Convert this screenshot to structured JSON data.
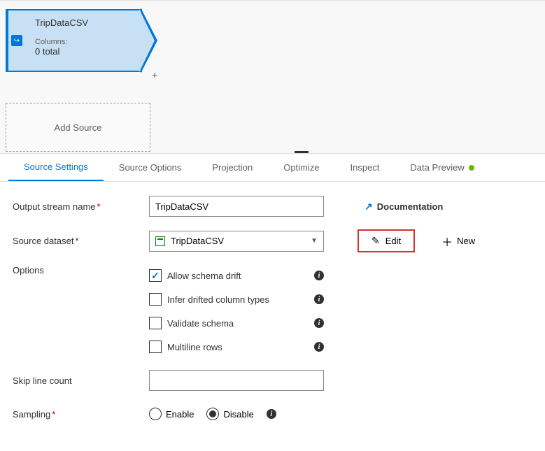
{
  "canvas": {
    "source": {
      "title": "TripDataCSV",
      "columns_label": "Columns:",
      "columns_count": "0 total"
    },
    "add_source_label": "Add Source"
  },
  "tabs": [
    {
      "label": "Source Settings",
      "active": true
    },
    {
      "label": "Source Options",
      "active": false
    },
    {
      "label": "Projection",
      "active": false
    },
    {
      "label": "Optimize",
      "active": false,
      "indicator": true
    },
    {
      "label": "Inspect",
      "active": false
    },
    {
      "label": "Data Preview",
      "active": false,
      "status": true
    }
  ],
  "form": {
    "output_stream": {
      "label": "Output stream name",
      "value": "TripDataCSV"
    },
    "documentation": {
      "label": "Documentation"
    },
    "source_dataset": {
      "label": "Source dataset",
      "value": "TripDataCSV"
    },
    "edit_label": "Edit",
    "new_label": "New",
    "options_label": "Options",
    "options": [
      {
        "label": "Allow schema drift",
        "checked": true
      },
      {
        "label": "Infer drifted column types",
        "checked": false
      },
      {
        "label": "Validate schema",
        "checked": false
      },
      {
        "label": "Multiline rows",
        "checked": false
      }
    ],
    "skip_line": {
      "label": "Skip line count",
      "value": ""
    },
    "sampling": {
      "label": "Sampling",
      "enable": "Enable",
      "disable": "Disable",
      "selected": "disable"
    }
  }
}
